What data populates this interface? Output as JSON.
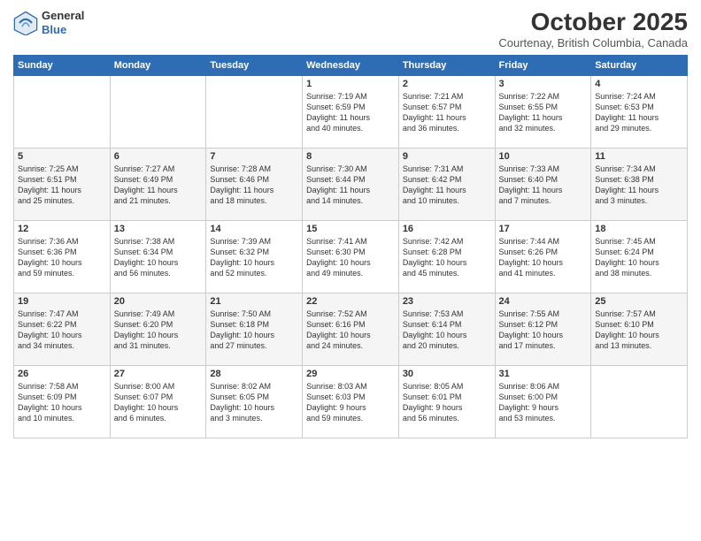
{
  "logo": {
    "general": "General",
    "blue": "Blue"
  },
  "title": "October 2025",
  "location": "Courtenay, British Columbia, Canada",
  "days_header": [
    "Sunday",
    "Monday",
    "Tuesday",
    "Wednesday",
    "Thursday",
    "Friday",
    "Saturday"
  ],
  "weeks": [
    [
      {
        "day": "",
        "info": ""
      },
      {
        "day": "",
        "info": ""
      },
      {
        "day": "",
        "info": ""
      },
      {
        "day": "1",
        "info": "Sunrise: 7:19 AM\nSunset: 6:59 PM\nDaylight: 11 hours\nand 40 minutes."
      },
      {
        "day": "2",
        "info": "Sunrise: 7:21 AM\nSunset: 6:57 PM\nDaylight: 11 hours\nand 36 minutes."
      },
      {
        "day": "3",
        "info": "Sunrise: 7:22 AM\nSunset: 6:55 PM\nDaylight: 11 hours\nand 32 minutes."
      },
      {
        "day": "4",
        "info": "Sunrise: 7:24 AM\nSunset: 6:53 PM\nDaylight: 11 hours\nand 29 minutes."
      }
    ],
    [
      {
        "day": "5",
        "info": "Sunrise: 7:25 AM\nSunset: 6:51 PM\nDaylight: 11 hours\nand 25 minutes."
      },
      {
        "day": "6",
        "info": "Sunrise: 7:27 AM\nSunset: 6:49 PM\nDaylight: 11 hours\nand 21 minutes."
      },
      {
        "day": "7",
        "info": "Sunrise: 7:28 AM\nSunset: 6:46 PM\nDaylight: 11 hours\nand 18 minutes."
      },
      {
        "day": "8",
        "info": "Sunrise: 7:30 AM\nSunset: 6:44 PM\nDaylight: 11 hours\nand 14 minutes."
      },
      {
        "day": "9",
        "info": "Sunrise: 7:31 AM\nSunset: 6:42 PM\nDaylight: 11 hours\nand 10 minutes."
      },
      {
        "day": "10",
        "info": "Sunrise: 7:33 AM\nSunset: 6:40 PM\nDaylight: 11 hours\nand 7 minutes."
      },
      {
        "day": "11",
        "info": "Sunrise: 7:34 AM\nSunset: 6:38 PM\nDaylight: 11 hours\nand 3 minutes."
      }
    ],
    [
      {
        "day": "12",
        "info": "Sunrise: 7:36 AM\nSunset: 6:36 PM\nDaylight: 10 hours\nand 59 minutes."
      },
      {
        "day": "13",
        "info": "Sunrise: 7:38 AM\nSunset: 6:34 PM\nDaylight: 10 hours\nand 56 minutes."
      },
      {
        "day": "14",
        "info": "Sunrise: 7:39 AM\nSunset: 6:32 PM\nDaylight: 10 hours\nand 52 minutes."
      },
      {
        "day": "15",
        "info": "Sunrise: 7:41 AM\nSunset: 6:30 PM\nDaylight: 10 hours\nand 49 minutes."
      },
      {
        "day": "16",
        "info": "Sunrise: 7:42 AM\nSunset: 6:28 PM\nDaylight: 10 hours\nand 45 minutes."
      },
      {
        "day": "17",
        "info": "Sunrise: 7:44 AM\nSunset: 6:26 PM\nDaylight: 10 hours\nand 41 minutes."
      },
      {
        "day": "18",
        "info": "Sunrise: 7:45 AM\nSunset: 6:24 PM\nDaylight: 10 hours\nand 38 minutes."
      }
    ],
    [
      {
        "day": "19",
        "info": "Sunrise: 7:47 AM\nSunset: 6:22 PM\nDaylight: 10 hours\nand 34 minutes."
      },
      {
        "day": "20",
        "info": "Sunrise: 7:49 AM\nSunset: 6:20 PM\nDaylight: 10 hours\nand 31 minutes."
      },
      {
        "day": "21",
        "info": "Sunrise: 7:50 AM\nSunset: 6:18 PM\nDaylight: 10 hours\nand 27 minutes."
      },
      {
        "day": "22",
        "info": "Sunrise: 7:52 AM\nSunset: 6:16 PM\nDaylight: 10 hours\nand 24 minutes."
      },
      {
        "day": "23",
        "info": "Sunrise: 7:53 AM\nSunset: 6:14 PM\nDaylight: 10 hours\nand 20 minutes."
      },
      {
        "day": "24",
        "info": "Sunrise: 7:55 AM\nSunset: 6:12 PM\nDaylight: 10 hours\nand 17 minutes."
      },
      {
        "day": "25",
        "info": "Sunrise: 7:57 AM\nSunset: 6:10 PM\nDaylight: 10 hours\nand 13 minutes."
      }
    ],
    [
      {
        "day": "26",
        "info": "Sunrise: 7:58 AM\nSunset: 6:09 PM\nDaylight: 10 hours\nand 10 minutes."
      },
      {
        "day": "27",
        "info": "Sunrise: 8:00 AM\nSunset: 6:07 PM\nDaylight: 10 hours\nand 6 minutes."
      },
      {
        "day": "28",
        "info": "Sunrise: 8:02 AM\nSunset: 6:05 PM\nDaylight: 10 hours\nand 3 minutes."
      },
      {
        "day": "29",
        "info": "Sunrise: 8:03 AM\nSunset: 6:03 PM\nDaylight: 9 hours\nand 59 minutes."
      },
      {
        "day": "30",
        "info": "Sunrise: 8:05 AM\nSunset: 6:01 PM\nDaylight: 9 hours\nand 56 minutes."
      },
      {
        "day": "31",
        "info": "Sunrise: 8:06 AM\nSunset: 6:00 PM\nDaylight: 9 hours\nand 53 minutes."
      },
      {
        "day": "",
        "info": ""
      }
    ]
  ]
}
